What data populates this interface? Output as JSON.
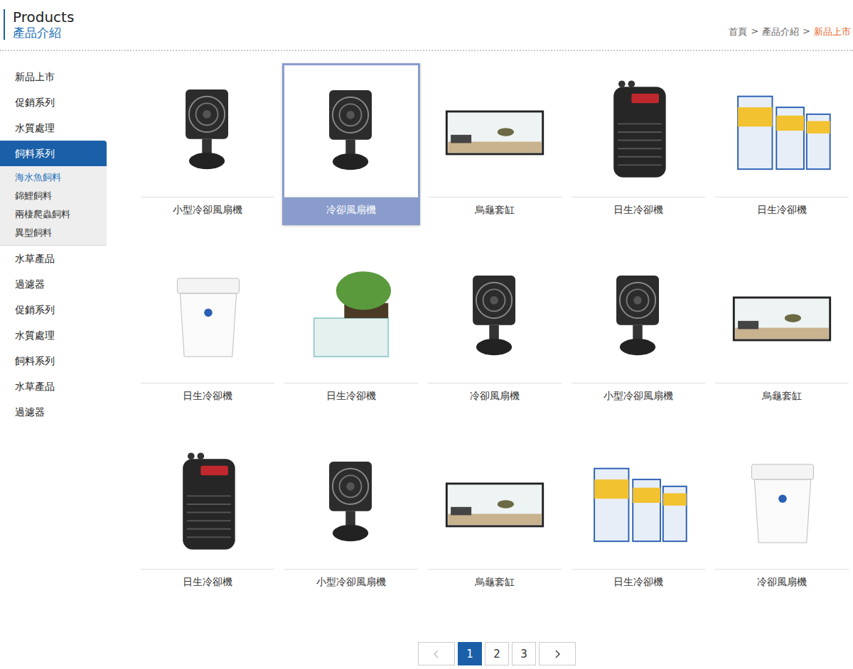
{
  "header": {
    "title": "Products",
    "subtitle": "產品介紹"
  },
  "breadcrumb": {
    "separator": ">",
    "items": [
      {
        "label": "首頁",
        "current": false
      },
      {
        "label": "產品介紹",
        "current": false
      },
      {
        "label": "新品上市",
        "current": true
      }
    ]
  },
  "sidebar": {
    "items": [
      {
        "label": "新品上市",
        "selected": false,
        "expanded": false,
        "children": []
      },
      {
        "label": "促銷系列",
        "selected": false,
        "expanded": false,
        "children": []
      },
      {
        "label": "水質處理",
        "selected": false,
        "expanded": false,
        "children": []
      },
      {
        "label": "飼料系列",
        "selected": true,
        "expanded": true,
        "children": [
          {
            "label": "海水魚飼料",
            "selected": true
          },
          {
            "label": "錦鯉飼料",
            "selected": false
          },
          {
            "label": "兩棲爬蟲飼料",
            "selected": false
          },
          {
            "label": "異型飼料",
            "selected": false
          }
        ]
      },
      {
        "label": "水草產品",
        "selected": false,
        "expanded": false,
        "children": []
      },
      {
        "label": "過濾器",
        "selected": false,
        "expanded": false,
        "children": []
      },
      {
        "label": "促銷系列",
        "selected": false,
        "expanded": false,
        "children": []
      },
      {
        "label": "水質處理",
        "selected": false,
        "expanded": false,
        "children": []
      },
      {
        "label": "飼料系列",
        "selected": false,
        "expanded": false,
        "children": []
      },
      {
        "label": "水草產品",
        "selected": false,
        "expanded": false,
        "children": []
      },
      {
        "label": "過濾器",
        "selected": false,
        "expanded": false,
        "children": []
      }
    ]
  },
  "products": [
    {
      "name": "小型冷卻風扇機",
      "kind": "fan",
      "selected": false
    },
    {
      "name": "冷卻風扇機",
      "kind": "fan",
      "selected": true
    },
    {
      "name": "烏龜套缸",
      "kind": "tank",
      "selected": false
    },
    {
      "name": "日生冷卻機",
      "kind": "chiller",
      "selected": false
    },
    {
      "name": "日生冷卻機",
      "kind": "salt",
      "selected": false
    },
    {
      "name": "日生冷卻機",
      "kind": "bucket",
      "selected": false
    },
    {
      "name": "日生冷卻機",
      "kind": "plant",
      "selected": false
    },
    {
      "name": "冷卻風扇機",
      "kind": "fan",
      "selected": false
    },
    {
      "name": "小型冷卻風扇機",
      "kind": "fan",
      "selected": false
    },
    {
      "name": "烏龜套缸",
      "kind": "tank",
      "selected": false
    },
    {
      "name": "日生冷卻機",
      "kind": "chiller",
      "selected": false
    },
    {
      "name": "小型冷卻風扇機",
      "kind": "fan",
      "selected": false
    },
    {
      "name": "烏龜套缸",
      "kind": "tank",
      "selected": false
    },
    {
      "name": "日生冷卻機",
      "kind": "salt",
      "selected": false
    },
    {
      "name": "冷卻風扇機",
      "kind": "bucket",
      "selected": false
    }
  ],
  "pagination": {
    "prev_disabled": true,
    "next_disabled": false,
    "pages": [
      {
        "label": "1",
        "selected": true
      },
      {
        "label": "2",
        "selected": false
      },
      {
        "label": "3",
        "selected": false
      }
    ]
  }
}
